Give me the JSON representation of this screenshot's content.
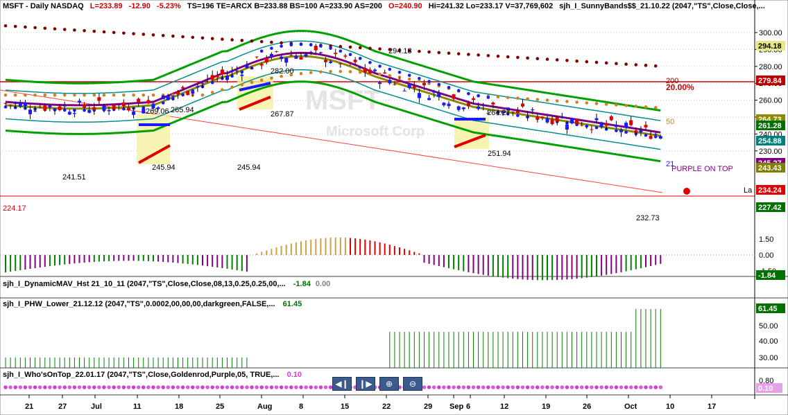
{
  "header": {
    "symbol": "MSFT - Daily  NASDAQ",
    "last": "L=233.89",
    "change": "-12.90",
    "change_pct": "-5.23%",
    "stats": "TS=196  TE=ARCX  B=233.88  BS=100  A=233.90  AS=200",
    "open": "O=240.90",
    "hi_lo_vol": "Hi=241.32  Lo=233.17  V=37,769,602",
    "study": "sjh_I_SunnyBands$$_21.10.22 (2047,\"TS\",Close,Close,..."
  },
  "watermark": {
    "ticker": "MSFT",
    "company": "Microsoft Corp"
  },
  "price_axis": {
    "ticks": [
      "300.00",
      "290.00",
      "280.00",
      "270.00",
      "260.00",
      "250.00",
      "240.00",
      "230.00"
    ],
    "badges": [
      {
        "text": "294.18",
        "color": "#e8e880",
        "fg": "#000"
      },
      {
        "text": "279.84",
        "color": "#c00000",
        "fg": "#fff"
      },
      {
        "text": "264.73",
        "color": "#8b8b00",
        "fg": "#fff"
      },
      {
        "text": "261.28",
        "color": "#007000",
        "fg": "#fff"
      },
      {
        "text": "254.88",
        "color": "#008080",
        "fg": "#fff"
      },
      {
        "text": "245.27",
        "color": "#800080",
        "fg": "#fff"
      },
      {
        "text": "243.43",
        "color": "#808000",
        "fg": "#fff"
      },
      {
        "text": "234.24",
        "color": "#e00000",
        "fg": "#fff"
      },
      {
        "text": "227.42",
        "color": "#007000",
        "fg": "#fff"
      }
    ]
  },
  "annotations": {
    "p1": "241.51",
    "p2": "269.06",
    "p3": "265.94",
    "p4": "245.94",
    "p5": "245.94",
    "p6": "282.00",
    "p7": "267.87",
    "p8": "294.18",
    "p9": "264.27",
    "p10": "251.94",
    "p11": "232.73",
    "level_low": "224.17",
    "pct": "20.00%",
    "tag200": "200",
    "tag50": "50",
    "tag21": "21",
    "purple_on_top": "PURPLE ON TOP",
    "la": "La"
  },
  "panes": {
    "dmav": {
      "label": "sjh_I_DynamicMAV_Hst 21_10_11 (2047,\"TS\",Close,Close,08,13,0.25,0.25,00,...",
      "val1": "-1.84",
      "val2": "0.00",
      "ticks": [
        "1.50",
        "0.00",
        "-1.50"
      ],
      "badge": "-1.84"
    },
    "phw": {
      "label": "sjh_I_PHW_Lower_21.12.12 (2047,\"TS\",0.0002,00,00,00,darkgreen,FALSE,...",
      "val": "61.45",
      "ticks": [
        "50.00",
        "40.00",
        "30.00"
      ],
      "badge": "61.45"
    },
    "wot": {
      "label": "sjh_I_Who'sOnTop_22.01.17 (2047,\"TS\",Close,Goldenrod,Purple,05, TRUE,...",
      "val": "0.10",
      "ticks": [
        "0.80",
        "0.10"
      ],
      "badge": "0.10"
    }
  },
  "toolbar": {
    "scroll_left": "scroll-left",
    "scroll_right": "scroll-right",
    "zoom_in": "zoom-in",
    "zoom_out": "zoom-out"
  },
  "date_axis": {
    "labels": [
      "21",
      "27",
      "Jul",
      "11",
      "18",
      "25",
      "Aug",
      "8",
      "15",
      "22",
      "29",
      "Sep",
      "6",
      "12",
      "19",
      "26",
      "Oct",
      "10",
      "17"
    ]
  },
  "colors": {
    "background": "#ffffff",
    "up": "#1a1aff",
    "down": "#e00000",
    "band": "#008000"
  }
}
